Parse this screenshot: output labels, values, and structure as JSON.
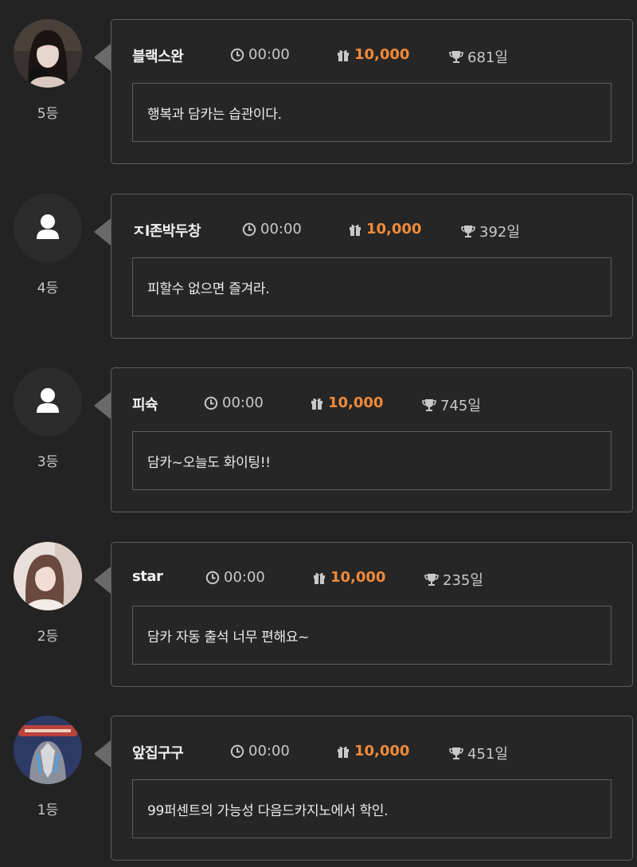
{
  "colors": {
    "background": "#232323",
    "card_border": "#5e5e5e",
    "points_accent": "#f08a3a",
    "muted_text": "#c8c8c8"
  },
  "entries": [
    {
      "avatar": "photo-avatar",
      "rank": "5등",
      "username": "블랙스완",
      "time": "00:00",
      "points": "10,000",
      "days": "681일",
      "comment": "행복과 담카는 습관이다."
    },
    {
      "avatar": "default-user-icon",
      "rank": "4등",
      "username": "ㅈl존박두창",
      "time": "00:00",
      "points": "10,000",
      "days": "392일",
      "comment": "피할수 없으면 즐겨라."
    },
    {
      "avatar": "default-user-icon",
      "rank": "3등",
      "username": "피슉",
      "time": "00:00",
      "points": "10,000",
      "days": "745일",
      "comment": "담카~오늘도 화이팅!!"
    },
    {
      "avatar": "photo-avatar",
      "rank": "2등",
      "username": "star",
      "time": "00:00",
      "points": "10,000",
      "days": "235일",
      "comment": "담카 자동 출석 너무 편해요~"
    },
    {
      "avatar": "cartoon-avatar",
      "rank": "1등",
      "username": "앞집구구",
      "time": "00:00",
      "points": "10,000",
      "days": "451일",
      "comment": "99퍼센트의 가능성 다음드카지노에서 학인."
    }
  ]
}
